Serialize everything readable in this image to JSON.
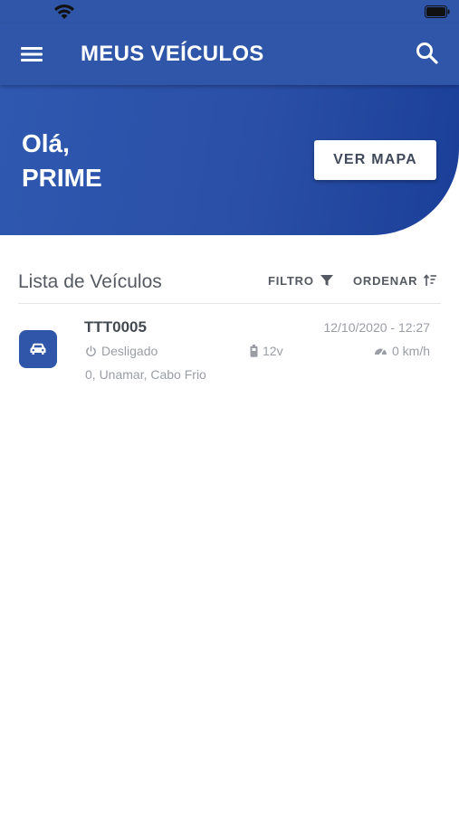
{
  "status_bar": {
    "wifi_icon": "wifi-icon",
    "battery_icon": "battery-icon"
  },
  "app_bar": {
    "menu_icon": "menu-icon",
    "title": "MEUS VEÍCULOS",
    "search_icon": "search-icon",
    "background": "#2f56a8"
  },
  "hero": {
    "greeting_line1": "Olá,",
    "greeting_line2": "PRIME",
    "map_button_label": "VER MAPA"
  },
  "list": {
    "title": "Lista de Veículos",
    "filter_label": "FILTRO",
    "filter_icon": "filter-icon",
    "sort_label": "ORDENAR",
    "sort_icon": "sort-icon",
    "vehicles": [
      {
        "icon": "car-icon",
        "plate": "TTT0005",
        "datetime": "12/10/2020 - 12:27",
        "status": "Desligado",
        "status_icon": "power-icon",
        "voltage": "12v",
        "voltage_icon": "battery-icon",
        "speed": "0 km/h",
        "speed_icon": "speedometer-icon",
        "address": "0, Unamar, Cabo Frio"
      }
    ]
  },
  "colors": {
    "primary": "#2f56a8",
    "hero_gradient_end": "#1a3f99",
    "muted_text": "#9a9ea4",
    "dark_text": "#444a52"
  }
}
